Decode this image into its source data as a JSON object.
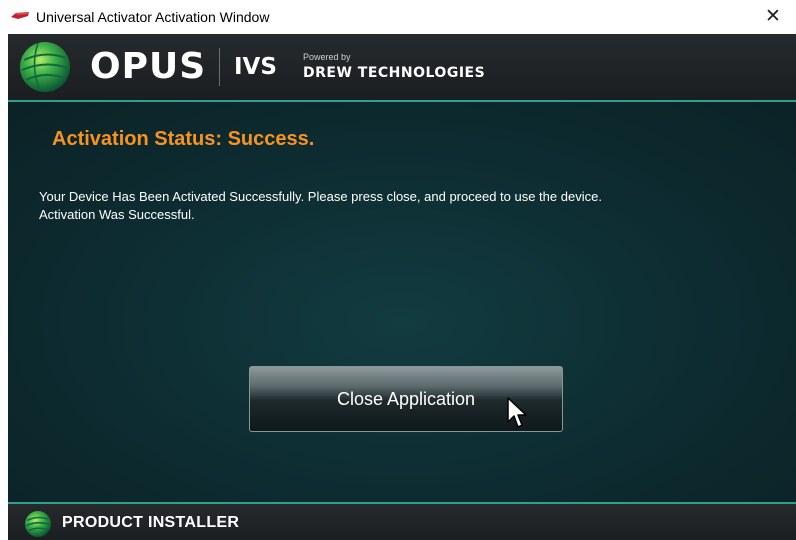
{
  "window": {
    "title": "Universal Activator Activation Window",
    "close_glyph": "✕",
    "app_icon": "red-device-icon"
  },
  "header": {
    "brand": "OPUS",
    "product": "IVS",
    "powered_by": "Powered by",
    "company": "DREW TECHNOLOGIES",
    "logo_icon": "globe-logo-icon"
  },
  "content": {
    "status_title": "Activation Status: Success.",
    "message_line1": "Your Device Has Been Activated Successfully. Please press close, and proceed to use the device.",
    "message_line2": "Activation Was Successful.",
    "close_button_label": "Close Application"
  },
  "footer": {
    "label": "PRODUCT INSTALLER",
    "logo_icon": "globe-logo-icon"
  },
  "colors": {
    "accent_orange": "#f7931e",
    "accent_teal": "#2fa08a",
    "panel_background": "#0d2a2f",
    "header_background": "#1f2326"
  }
}
